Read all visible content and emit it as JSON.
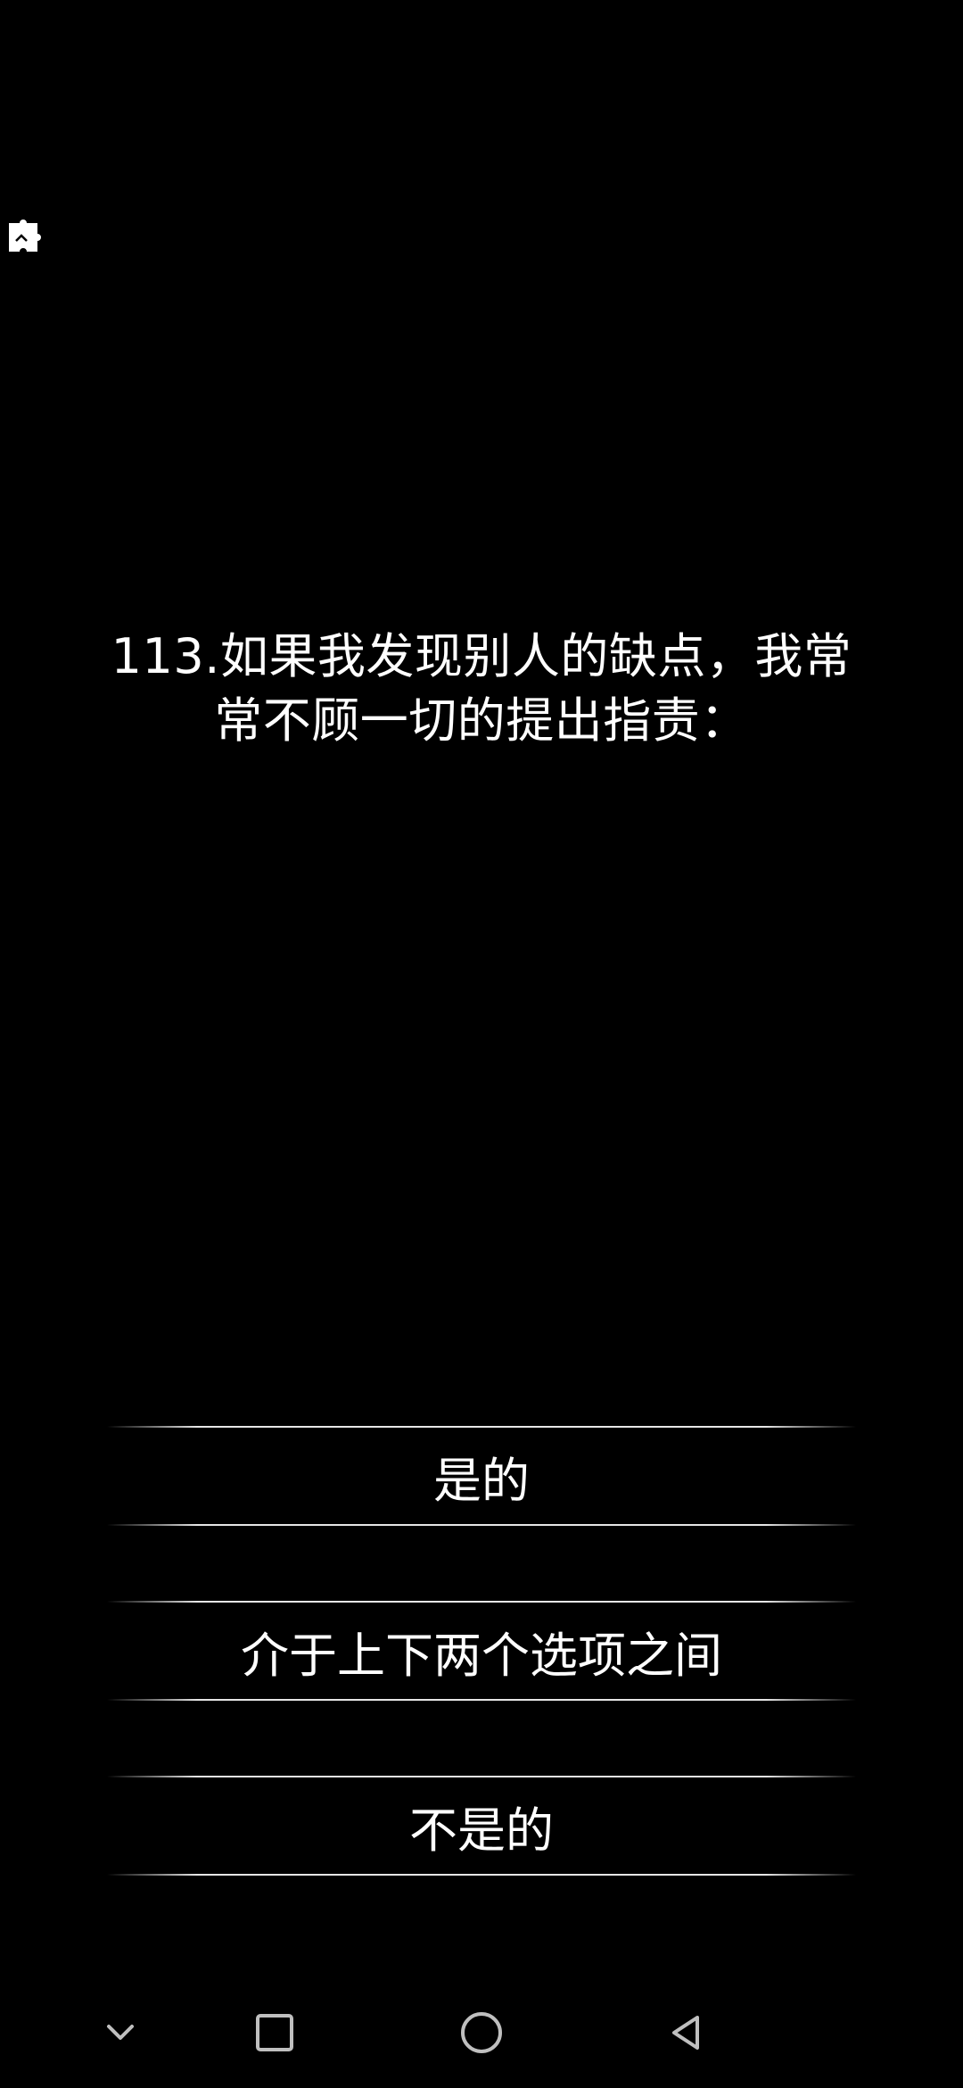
{
  "question": {
    "text": "113.如果我发现别人的缺点，我常\n常不顾一切的提出指责："
  },
  "options": [
    {
      "label": "是的"
    },
    {
      "label": "介于上下两个选项之间"
    },
    {
      "label": "不是的"
    }
  ],
  "icons": {
    "top_left": "puzzle-icon",
    "nav": [
      "chevron-down-icon",
      "square-icon",
      "circle-icon",
      "back-triangle-icon"
    ]
  },
  "colors": {
    "background": "#000000",
    "text": "#ffffff",
    "nav_icon": "#bfbfbf"
  }
}
